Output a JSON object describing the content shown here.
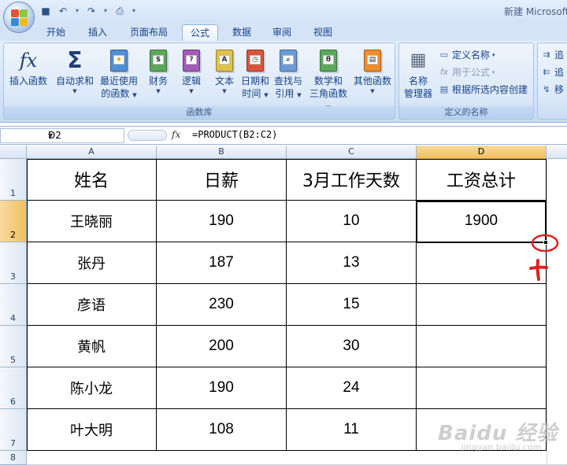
{
  "window": {
    "title": "新建 Microsoft"
  },
  "tabs": [
    "开始",
    "插入",
    "页面布局",
    "公式",
    "数据",
    "审阅",
    "视图"
  ],
  "active_tab": "公式",
  "ribbon": {
    "function_library": {
      "label": "函数库",
      "insert_function": "插入函数",
      "autosum": "自动求和",
      "recent": "最近使用的函数",
      "recent_line1": "最近使用",
      "recent_line2": "的函数",
      "financial": "财务",
      "logical": "逻辑",
      "text": "文本",
      "datetime_line1": "日期和",
      "datetime_line2": "时间",
      "lookup_line1": "查找与",
      "lookup_line2": "引用",
      "math_line1": "数学和",
      "math_line2": "三角函数",
      "other": "其他函数"
    },
    "defined_names": {
      "label": "定义的名称",
      "name_manager_line1": "名称",
      "name_manager_line2": "管理器",
      "define_name": "定义名称",
      "use_in_formula": "用于公式",
      "create_from_selection": "根据所选内容创建"
    },
    "formula_auditing_partial": {
      "trace1": "追",
      "trace2": "追",
      "remove": "移"
    }
  },
  "formula_bar": {
    "name_box": "D2",
    "fx_label": "fx",
    "formula": "=PRODUCT(B2:C2)"
  },
  "sheet": {
    "columns": [
      "A",
      "B",
      "C",
      "D"
    ],
    "rows": [
      "1",
      "2",
      "3",
      "4",
      "5",
      "6",
      "7",
      "8"
    ],
    "selected_cell": "D2",
    "headers": [
      "姓名",
      "日薪",
      "3月工作天数",
      "工资总计"
    ],
    "data": [
      [
        "王晓丽",
        "190",
        "10",
        "1900"
      ],
      [
        "张丹",
        "187",
        "13",
        ""
      ],
      [
        "彦语",
        "230",
        "15",
        ""
      ],
      [
        "黄帆",
        "200",
        "30",
        ""
      ],
      [
        "陈小龙",
        "190",
        "24",
        ""
      ],
      [
        "叶大明",
        "108",
        "11",
        ""
      ]
    ]
  },
  "annotation_color": "#e02020",
  "watermark": {
    "brand": "Baidu 经验",
    "url": "jingyan.baidu.com"
  }
}
